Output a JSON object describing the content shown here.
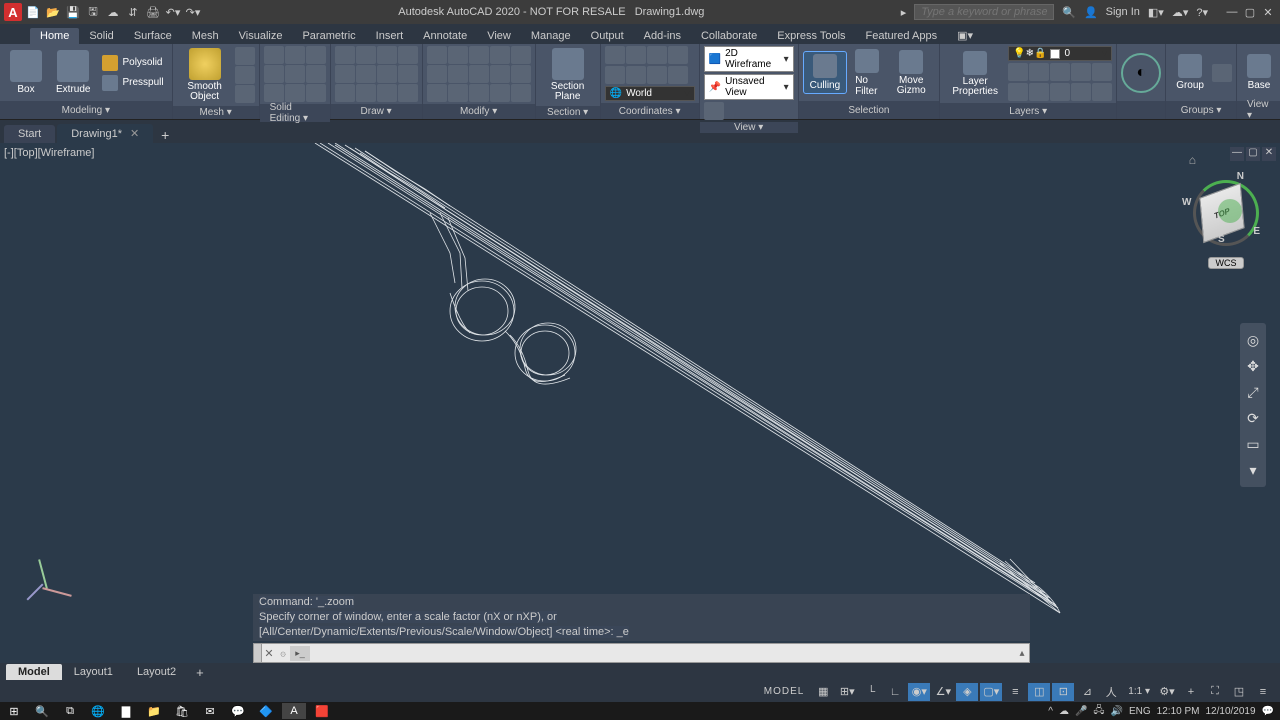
{
  "title": {
    "app": "Autodesk AutoCAD 2020 - NOT FOR RESALE",
    "document": "Drawing1.dwg",
    "search_placeholder": "Type a keyword or phrase",
    "signin": "Sign In"
  },
  "ribbon": {
    "tabs": [
      "Home",
      "Solid",
      "Surface",
      "Mesh",
      "Visualize",
      "Parametric",
      "Insert",
      "Annotate",
      "View",
      "Manage",
      "Output",
      "Add-ins",
      "Collaborate",
      "Express Tools",
      "Featured Apps"
    ],
    "active_tab": "Home",
    "modeling": {
      "panel": "Modeling ▾",
      "box": "Box",
      "extrude": "Extrude",
      "polysolid": "Polysolid",
      "presspull": "Presspull",
      "smooth": "Smooth Object"
    },
    "mesh_panel": "Mesh ▾",
    "solid_editing_panel": "Solid Editing ▾",
    "draw_panel": "Draw ▾",
    "modify_panel": "Modify ▾",
    "section": {
      "label": "Section Plane",
      "panel": "Section ▾"
    },
    "coordinates": {
      "world": "World",
      "panel": "Coordinates ▾"
    },
    "view": {
      "wireframe2d": "2D Wireframe",
      "unsaved_view": "Unsaved View",
      "panel": "View ▾"
    },
    "selection": {
      "culling": "Culling",
      "no_filter": "No Filter",
      "move_gizmo": "Move Gizmo",
      "panel": "Selection"
    },
    "layers": {
      "layer_props": "Layer Properties",
      "current": "0",
      "panel": "Layers ▾"
    },
    "groups": {
      "group": "Group",
      "panel": "Groups ▾"
    },
    "view2": {
      "base": "Base",
      "panel": "View ▾"
    }
  },
  "doc_tabs": {
    "start": "Start",
    "drawing": "Drawing1*"
  },
  "drawing": {
    "view_label": "[-][Top][Wireframe]",
    "viewcube_face": "TOP",
    "wcs": "WCS",
    "compass": {
      "n": "N",
      "s": "S",
      "e": "E",
      "w": "W"
    }
  },
  "command": {
    "hist1_label": "Command:",
    "hist1_cmd": "'_.zoom",
    "hist2": "Specify corner of window, enter a scale factor (nX or nXP), or",
    "hist3": "[All/Center/Dynamic/Extents/Previous/Scale/Window/Object] <real time>: _e"
  },
  "layouts": {
    "model": "Model",
    "l1": "Layout1",
    "l2": "Layout2"
  },
  "status": {
    "model": "MODEL",
    "scale": "1:1 ▾"
  },
  "taskbar": {
    "lang": "ENG",
    "time": "12:10 PM",
    "date": "12/10/2019"
  }
}
